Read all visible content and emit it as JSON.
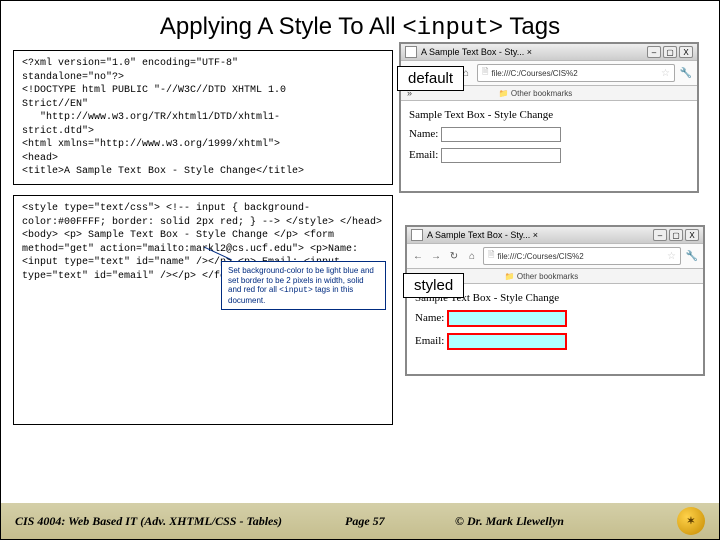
{
  "title": {
    "pre": "Applying A Style To All ",
    "tag": "<input>",
    "post": " Tags"
  },
  "code_top": "<?xml version=\"1.0\" encoding=\"UTF-8\"\nstandalone=\"no\"?>\n<!DOCTYPE html PUBLIC \"-//W3C//DTD XHTML 1.0\nStrict//EN\"\n   \"http://www.w3.org/TR/xhtml1/DTD/xhtml1-\nstrict.dtd\">\n<html xmlns=\"http://www.w3.org/1999/xhtml\">\n<head>\n<title>A Sample Text Box - Style Change</title>",
  "code_bottom": "<style type=\"text/css\">\n   <!--  input { background-color:#00FFFF;\n                border: solid 2px red; }\n   -->\n</style>\n\n</head>\n<body>\n <p> Sample Text Box - Style Change </p>\n<form method=\"get\"\naction=\"mailto:markl2@cs.ucf.edu\">\n   <p>Name: <input type=\"text\" id=\"name\"  /></p>\n   <p> Email: <input type=\"text\" id=\"email\" /></p>\n</form>\n</body>\n</html>",
  "callout": {
    "line1": "Set background-color to be light blue and set border to be 2 pixels in width, solid and red for all ",
    "tag": "<input>",
    "line2": " tags in this document."
  },
  "labels": {
    "default": "default",
    "styled": "styled"
  },
  "browser": {
    "tab_title": "A Sample Text Box - Sty... ×",
    "url": "file:///C:/Courses/CIS%2",
    "bookmarks_hint": "»    Other bookmarks",
    "page_heading": "Sample Text Box - Style Change",
    "name_label": "Name:",
    "email_label": "Email:"
  },
  "footer": {
    "course": "CIS 4004: Web Based IT (Adv. XHTML/CSS - Tables)",
    "page": "Page 57",
    "copyright": "© Dr. Mark Llewellyn"
  }
}
